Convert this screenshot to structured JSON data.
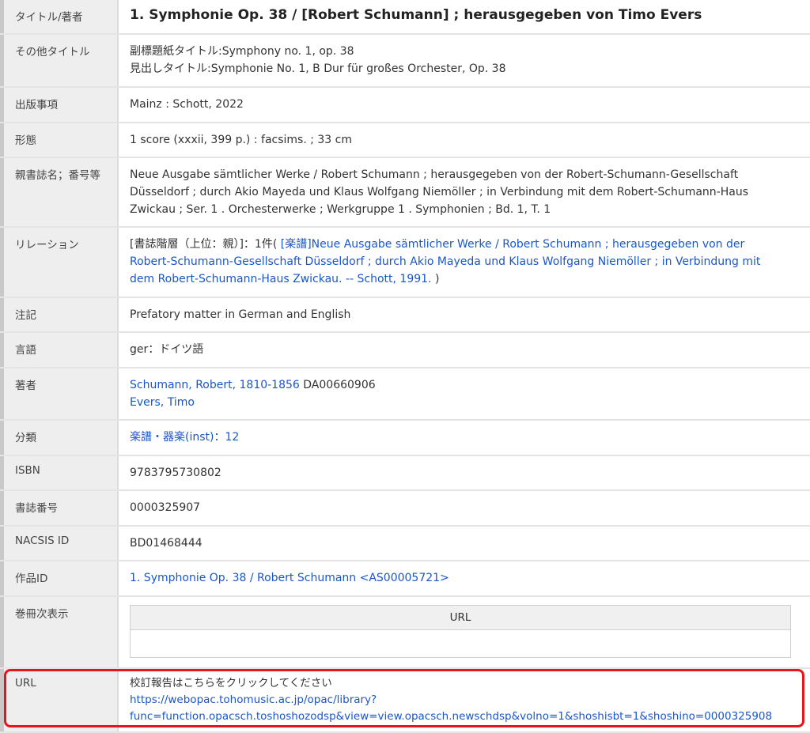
{
  "rows": {
    "title": {
      "label": "タイトル/著者",
      "value": "1. Symphonie Op. 38 / [Robert Schumann] ; herausgegeben von Timo Evers"
    },
    "other_title": {
      "label": "その他タイトル",
      "line1": "副標題紙タイトル:Symphony no. 1, op. 38",
      "line2": "見出しタイトル:Symphonie No. 1, B Dur für großes Orchester, Op. 38"
    },
    "publication": {
      "label": "出版事項",
      "value": "Mainz : Schott, 2022"
    },
    "form": {
      "label": "形態",
      "value": "1 score (xxxii, 399 p.) : facsims. ; 33 cm"
    },
    "series": {
      "label": "親書誌名；番号等",
      "line1": "Neue Ausgabe sämtlicher Werke / Robert Schumann ; herausgegeben von der Robert-Schumann-Gesellschaft",
      "line2": "Düsseldorf ; durch Akio Mayeda und Klaus Wolfgang Niemöller ; in Verbindung mit dem Robert-Schumann-Haus",
      "line3": "Zwickau ; Ser. 1 . Orchesterwerke ; Werkgruppe 1 . Symphonien ; Bd. 1, T. 1"
    },
    "relation": {
      "label": "リレーション",
      "prefix": "[書誌階層（上位：親）]：1件(",
      "link_line1": "[楽譜]Neue Ausgabe sämtlicher Werke / Robert Schumann ; herausgegeben von der",
      "link_line2": "Robert-Schumann-Gesellschaft Düsseldorf ; durch Akio Mayeda und Klaus Wolfgang Niemöller ; in Verbindung mit",
      "link_line3": "dem Robert-Schumann-Haus Zwickau. -- Schott, 1991.",
      "suffix": " )"
    },
    "note": {
      "label": "注記",
      "value": "Prefatory matter in German and English"
    },
    "language": {
      "label": "言語",
      "value": "ger：ドイツ語"
    },
    "author": {
      "label": "著者",
      "author1_link": "Schumann, Robert, 1810-1856",
      "author1_id": " DA00660906",
      "author2_link": "Evers, Timo"
    },
    "classification": {
      "label": "分類",
      "value": "楽譜・器楽(inst)：12"
    },
    "isbn": {
      "label": "ISBN",
      "value": "9783795730802"
    },
    "bib_no": {
      "label": "書誌番号",
      "value": "0000325907"
    },
    "nacsis": {
      "label": "NACSIS ID",
      "value": "BD01468444"
    },
    "work_id": {
      "label": "作品ID",
      "value": "1. Symphonie Op. 38 / Robert Schumann <AS00005721>"
    },
    "volumes": {
      "label": "巻冊次表示",
      "column": "URL"
    },
    "url": {
      "label": "URL",
      "text": "校訂報告はこちらをクリックしてください",
      "link_line1": "https://webopac.tohomusic.ac.jp/opac/library?",
      "link_line2": "func=function.opacsch.toshoshozodsp&view=view.opacsch.newschdsp&volno=1&shoshisbt=1&shoshino=0000325908"
    }
  },
  "colors": {
    "link": "#1a56c9",
    "highlight": "#e8141c"
  }
}
